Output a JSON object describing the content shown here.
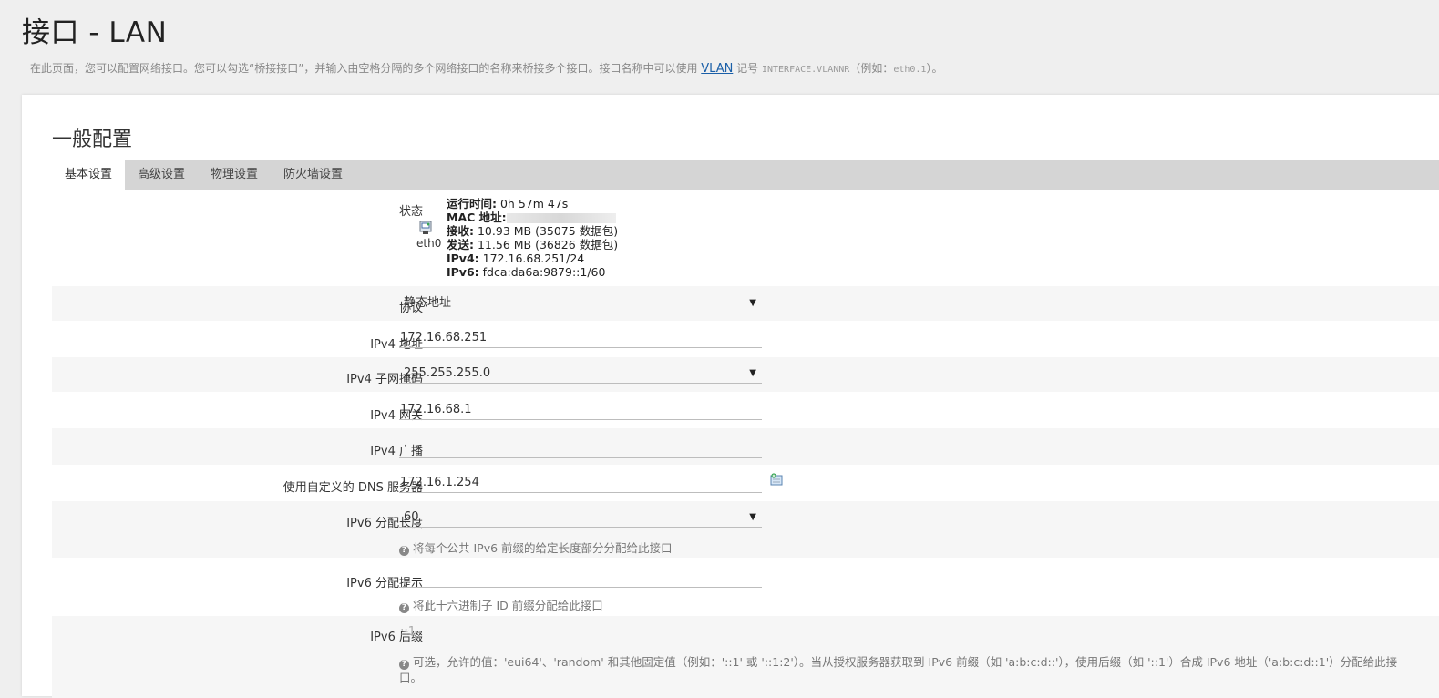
{
  "page": {
    "title": "接口 - LAN",
    "desc_before": "在此页面，您可以配置网络接口。您可以勾选“桥接接口”，并输入由空格分隔的多个网络接口的名称来桥接多个接口。接口名称中可以使用 ",
    "desc_link": "VLAN",
    "desc_mid": " 记号 ",
    "desc_code": "INTERFACE.VLANNR",
    "desc_paren_open": "（例如：",
    "desc_code2": "eth0.1",
    "desc_end": "）。"
  },
  "section": {
    "title": "一般配置"
  },
  "tabs": [
    "基本设置",
    "高级设置",
    "物理设置",
    "防火墙设置"
  ],
  "status": {
    "label": "状态",
    "iface": "eth0",
    "uptime_label": "运行时间:",
    "uptime": "0h 57m 47s",
    "mac_label": "MAC 地址:",
    "rx_label": "接收:",
    "rx": "10.93 MB (35075 数据包)",
    "tx_label": "发送:",
    "tx": "11.56 MB (36826 数据包)",
    "ipv4_label": "IPv4:",
    "ipv4": "172.16.68.251/24",
    "ipv6_label": "IPv6:",
    "ipv6": "fdca:da6a:9879::1/60"
  },
  "fields": {
    "protocol": {
      "label": "协议",
      "value": "静态地址"
    },
    "ipv4_addr": {
      "label": "IPv4 地址",
      "value": "172.16.68.251"
    },
    "ipv4_mask": {
      "label": "IPv4 子网掩码",
      "value": "255.255.255.0"
    },
    "ipv4_gw": {
      "label": "IPv4 网关",
      "value": "172.16.68.1"
    },
    "ipv4_bcast": {
      "label": "IPv4 广播",
      "value": ""
    },
    "dns": {
      "label": "使用自定义的 DNS 服务器",
      "value": "172.16.1.254"
    },
    "ipv6_assign_len": {
      "label": "IPv6 分配长度",
      "value": "60",
      "hint": "将每个公共 IPv6 前缀的给定长度部分分配给此接口"
    },
    "ipv6_hint": {
      "label": "IPv6 分配提示",
      "value": "",
      "hint": "将此十六进制子 ID 前缀分配给此接口"
    },
    "ipv6_suffix": {
      "label": "IPv6 后缀",
      "value": "::1",
      "hint": "可选，允许的值：'eui64'、'random' 和其他固定值（例如：'::1' 或 '::1:2'）。当从授权服务器获取到 IPv6 前缀（如 'a:b:c:d::'），使用后缀（如 '::1'）合成 IPv6 地址（'a:b:c:d::1'）分配给此接口。"
    }
  },
  "icons": {
    "status": "network-port-icon",
    "add": "add-dns-icon",
    "hint": "help-circle-icon",
    "select": "caret-down-icon"
  },
  "colors": {
    "link": "#1a5fa8",
    "tab_bar": "#d5d5d5",
    "row_alt": "#f6f6f6"
  }
}
